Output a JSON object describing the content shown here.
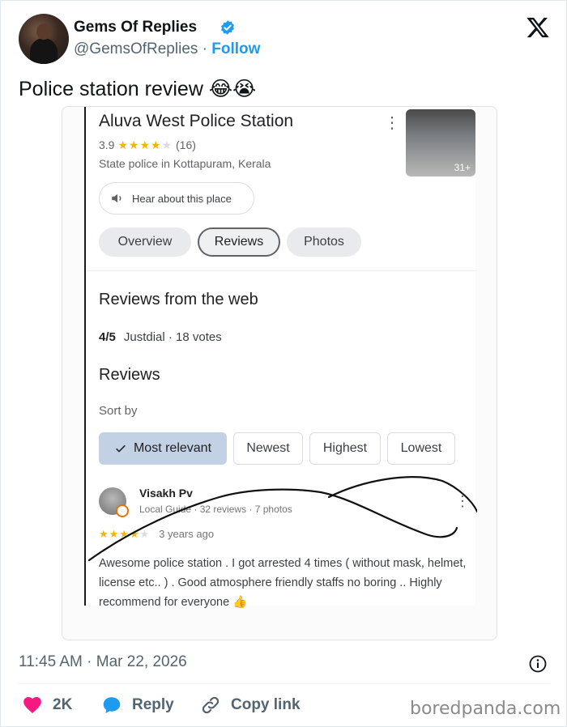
{
  "author": {
    "name": "Gems Of Replies",
    "handle": "@GemsOfReplies",
    "separator": " · ",
    "follow_label": "Follow"
  },
  "tweet": {
    "text": "Police station review 😂😭",
    "timestamp": "11:45 AM · Mar 22, 2026"
  },
  "screenshot": {
    "place_name": "Aluva West Police Station",
    "rating": "3.9",
    "rating_count": "(16)",
    "stars_filled": 4,
    "category": "State police in Kottapuram, Kerala",
    "photo_count": "31+",
    "hear_label": "Hear about this place",
    "tabs": [
      {
        "label": "Overview",
        "active": false
      },
      {
        "label": "Reviews",
        "active": true
      },
      {
        "label": "Photos",
        "active": false
      }
    ],
    "web_heading": "Reviews from the web",
    "web_score": "4/5",
    "web_source": "Justdial · 18 votes",
    "reviews_heading": "Reviews",
    "sort_label": "Sort by",
    "sort_options": [
      {
        "label": "Most relevant",
        "selected": true
      },
      {
        "label": "Newest",
        "selected": false
      },
      {
        "label": "Highest",
        "selected": false
      },
      {
        "label": "Lowest",
        "selected": false
      }
    ],
    "review": {
      "name": "Visakh Pv",
      "meta": "Local Guide · 32 reviews · 7 photos",
      "stars": 4,
      "age": "3 years ago",
      "text": "Awesome police station . I got arrested 4 times ( without mask, helmet, license etc.. ) . Good atmosphere friendly staffs no boring .. Highly recommend for everyone 👍"
    }
  },
  "actions": {
    "like_count": "2K",
    "reply_label": "Reply",
    "copy_label": "Copy link"
  },
  "watermark": "boredpanda.com",
  "colors": {
    "accent": "#1d9bf0",
    "like": "#f91880",
    "star": "#f4b400",
    "chip_selected": "#c2d1e4"
  },
  "icons": [
    "verified-badge-icon",
    "x-logo-icon",
    "speaker-icon",
    "checkmark-icon",
    "info-icon",
    "heart-icon",
    "reply-bubble-icon",
    "link-icon"
  ]
}
